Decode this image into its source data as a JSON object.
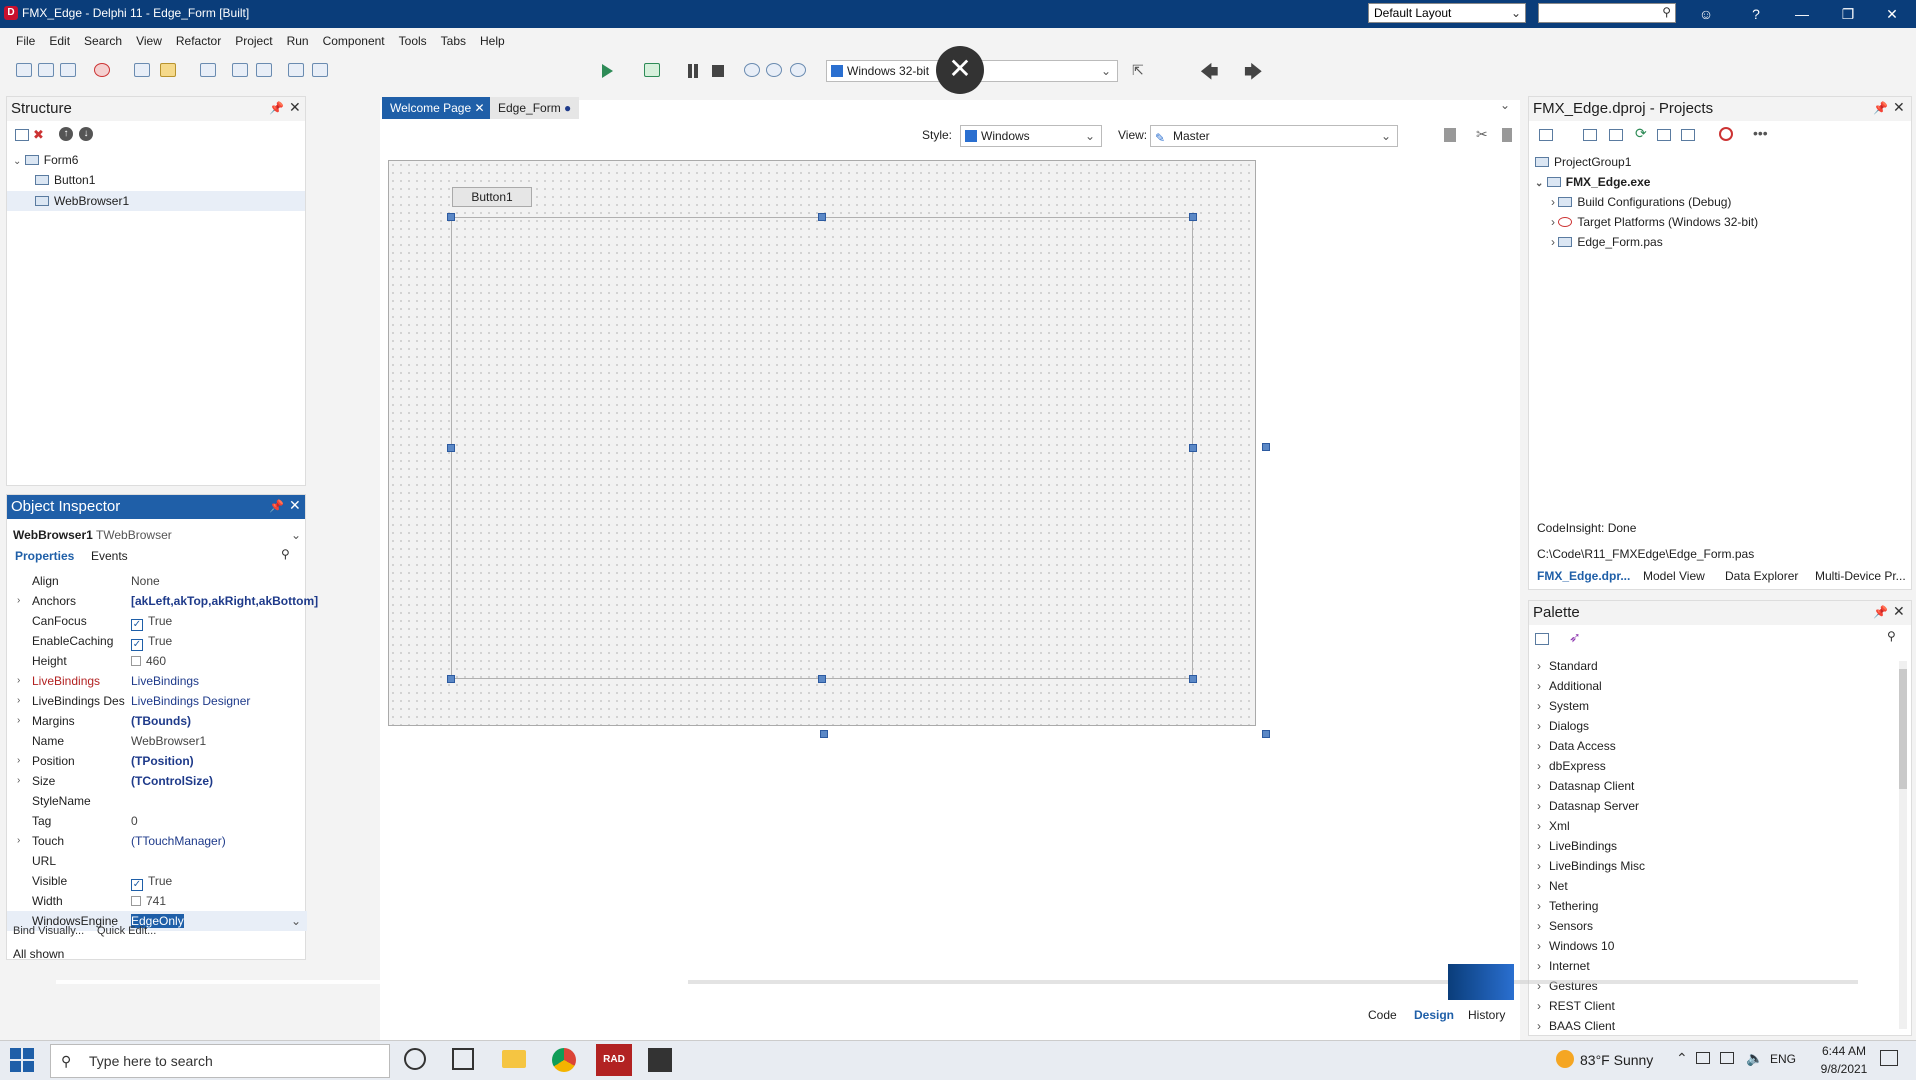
{
  "titlebar": {
    "title": "FMX_Edge - Delphi 11 - Edge_Form [Built]",
    "layout": "Default Layout",
    "help": "?"
  },
  "menu": [
    "File",
    "Edit",
    "Search",
    "View",
    "Refactor",
    "Project",
    "Run",
    "Component",
    "Tools",
    "Tabs",
    "Help"
  ],
  "toolbar": {
    "platform": "Windows 32-bit"
  },
  "structure": {
    "title": "Structure",
    "items": [
      "Form6",
      "Button1",
      "WebBrowser1"
    ]
  },
  "object_inspector": {
    "title": "Object Inspector",
    "object_name": "WebBrowser1",
    "object_type": "TWebBrowser",
    "tabs": [
      "Properties",
      "Events"
    ],
    "rows": [
      {
        "name": "Align",
        "value": "None"
      },
      {
        "name": "Anchors",
        "value": "[akLeft,akTop,akRight,akBottom]"
      },
      {
        "name": "CanFocus",
        "value": "True"
      },
      {
        "name": "EnableCaching",
        "value": "True"
      },
      {
        "name": "Height",
        "value": "460"
      },
      {
        "name": "LiveBindings",
        "value": "LiveBindings"
      },
      {
        "name": "LiveBindings Des",
        "value": "LiveBindings Designer"
      },
      {
        "name": "Margins",
        "value": "(TBounds)"
      },
      {
        "name": "Name",
        "value": "WebBrowser1"
      },
      {
        "name": "Position",
        "value": "(TPosition)"
      },
      {
        "name": "Size",
        "value": "(TControlSize)"
      },
      {
        "name": "StyleName",
        "value": ""
      },
      {
        "name": "Tag",
        "value": "0"
      },
      {
        "name": "Touch",
        "value": "(TTouchManager)"
      },
      {
        "name": "URL",
        "value": ""
      },
      {
        "name": "Visible",
        "value": "True"
      },
      {
        "name": "Width",
        "value": "741"
      },
      {
        "name": "WindowsEngine",
        "value": "EdgeOnly"
      }
    ],
    "bottom_links": [
      "Bind Visually...",
      "Quick Edit..."
    ],
    "status": "All shown"
  },
  "designer": {
    "tabs": [
      "Welcome Page",
      "Edge_Form"
    ],
    "style_label": "Style:",
    "style_value": "Windows",
    "view_label": "View:",
    "view_value": "Master",
    "button_caption": "Button1",
    "bottom_tabs": [
      "Code",
      "Design",
      "History"
    ]
  },
  "projects": {
    "title": "FMX_Edge.dproj - Projects",
    "items": [
      "ProjectGroup1",
      "FMX_Edge.exe",
      "Build Configurations (Debug)",
      "Target Platforms (Windows 32-bit)",
      "Edge_Form.pas"
    ],
    "codeinsight": "CodeInsight: Done",
    "path": "C:\\Code\\R11_FMXEdge\\Edge_Form.pas",
    "tabs": [
      "FMX_Edge.dpr...",
      "Model View",
      "Data Explorer",
      "Multi-Device Pr..."
    ]
  },
  "palette": {
    "title": "Palette",
    "items": [
      "Standard",
      "Additional",
      "System",
      "Dialogs",
      "Data Access",
      "dbExpress",
      "Datasnap Client",
      "Datasnap Server",
      "Xml",
      "LiveBindings",
      "LiveBindings Misc",
      "Net",
      "Tethering",
      "Sensors",
      "Windows 10",
      "Internet",
      "Gestures",
      "REST Client",
      "BAAS Client"
    ]
  },
  "taskbar": {
    "search": "Type here to search",
    "weather": "83°F  Sunny",
    "lang": "ENG",
    "time": "6:44 AM",
    "date": "9/8/2021"
  }
}
